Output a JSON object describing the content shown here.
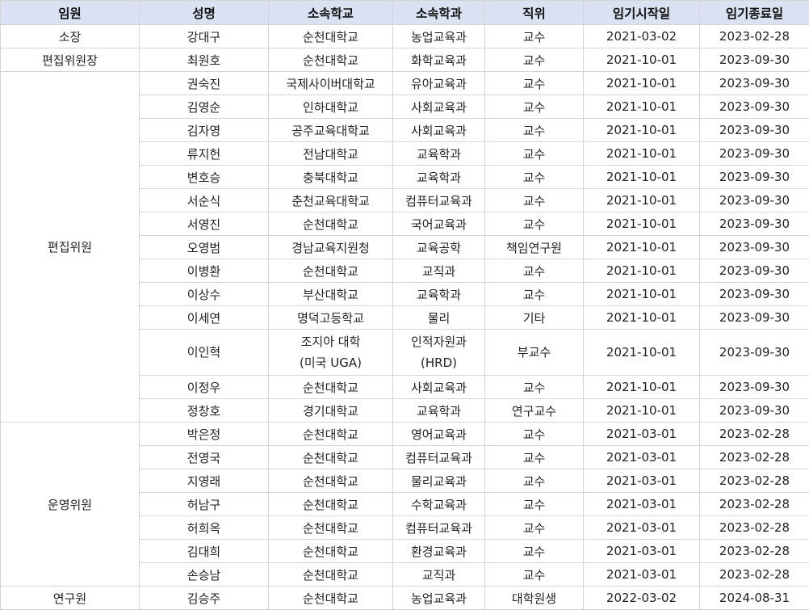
{
  "headers": [
    "임원",
    "성명",
    "소속학교",
    "소속학과",
    "직위",
    "임기시작일",
    "임기종료일"
  ],
  "groups": [
    {
      "role": "소장",
      "members": [
        {
          "name": "강대구",
          "school": "순천대학교",
          "dept": "농업교육과",
          "position": "교수",
          "start": "2021-03-02",
          "end": "2023-02-28"
        }
      ]
    },
    {
      "role": "편집위원장",
      "members": [
        {
          "name": "최원호",
          "school": "순천대학교",
          "dept": "화학교육과",
          "position": "교수",
          "start": "2021-10-01",
          "end": "2023-09-30"
        }
      ]
    },
    {
      "role": "편집위원",
      "members": [
        {
          "name": "권숙진",
          "school": "국제사이버대학교",
          "dept": "유아교육과",
          "position": "교수",
          "start": "2021-10-01",
          "end": "2023-09-30"
        },
        {
          "name": "김영순",
          "school": "인하대학교",
          "dept": "사회교육과",
          "position": "교수",
          "start": "2021-10-01",
          "end": "2023-09-30"
        },
        {
          "name": "김자영",
          "school": "공주교육대학교",
          "dept": "사회교육과",
          "position": "교수",
          "start": "2021-10-01",
          "end": "2023-09-30"
        },
        {
          "name": "류지헌",
          "school": "전남대학교",
          "dept": "교육학과",
          "position": "교수",
          "start": "2021-10-01",
          "end": "2023-09-30"
        },
        {
          "name": "변호승",
          "school": "충북대학교",
          "dept": "교육학과",
          "position": "교수",
          "start": "2021-10-01",
          "end": "2023-09-30"
        },
        {
          "name": "서순식",
          "school": "춘천교육대학교",
          "dept": "컴퓨터교육과",
          "position": "교수",
          "start": "2021-10-01",
          "end": "2023-09-30"
        },
        {
          "name": "서영진",
          "school": "순천대학교",
          "dept": "국어교육과",
          "position": "교수",
          "start": "2021-10-01",
          "end": "2023-09-30"
        },
        {
          "name": "오영범",
          "school": "경남교육지원청",
          "dept": "교육공학",
          "position": "책임연구원",
          "start": "2021-10-01",
          "end": "2023-09-30"
        },
        {
          "name": "이병환",
          "school": "순천대학교",
          "dept": "교직과",
          "position": "교수",
          "start": "2021-10-01",
          "end": "2023-09-30"
        },
        {
          "name": "이상수",
          "school": "부산대학교",
          "dept": "교육학과",
          "position": "교수",
          "start": "2021-10-01",
          "end": "2023-09-30"
        },
        {
          "name": "이세연",
          "school": "명덕고등학교",
          "dept": "물리",
          "position": "기타",
          "start": "2021-10-01",
          "end": "2023-09-30"
        },
        {
          "name": "이인혁",
          "school": [
            "조지아 대학",
            "(미국 UGA)"
          ],
          "dept": [
            "인적자원과",
            "(HRD)"
          ],
          "position": "부교수",
          "start": "2021-10-01",
          "end": "2023-09-30"
        },
        {
          "name": "이정우",
          "school": "순천대학교",
          "dept": "사회교육과",
          "position": "교수",
          "start": "2021-10-01",
          "end": "2023-09-30"
        },
        {
          "name": "정창호",
          "school": "경기대학교",
          "dept": "교육학과",
          "position": "연구교수",
          "start": "2021-10-01",
          "end": "2023-09-30"
        }
      ]
    },
    {
      "role": "운영위원",
      "members": [
        {
          "name": "박은정",
          "school": "순천대학교",
          "dept": "영어교육과",
          "position": "교수",
          "start": "2021-03-01",
          "end": "2023-02-28"
        },
        {
          "name": "전영국",
          "school": "순천대학교",
          "dept": "컴퓨터교육과",
          "position": "교수",
          "start": "2021-03-01",
          "end": "2023-02-28"
        },
        {
          "name": "지영래",
          "school": "순천대학교",
          "dept": "물리교육과",
          "position": "교수",
          "start": "2021-03-01",
          "end": "2023-02-28"
        },
        {
          "name": "허남구",
          "school": "순천대학교",
          "dept": "수학교육과",
          "position": "교수",
          "start": "2021-03-01",
          "end": "2023-02-28"
        },
        {
          "name": "허희옥",
          "school": "순천대학교",
          "dept": "컴퓨터교육과",
          "position": "교수",
          "start": "2021-03-01",
          "end": "2023-02-28"
        },
        {
          "name": "김대희",
          "school": "순천대학교",
          "dept": "환경교육과",
          "position": "교수",
          "start": "2021-03-01",
          "end": "2023-02-28"
        },
        {
          "name": "손승남",
          "school": "순천대학교",
          "dept": "교직과",
          "position": "교수",
          "start": "2021-03-01",
          "end": "2023-02-28"
        }
      ]
    },
    {
      "role": "연구원",
      "members": [
        {
          "name": "김승주",
          "school": "순천대학교",
          "dept": "농업교육과",
          "position": "대학원생",
          "start": "2022-03-02",
          "end": "2024-08-31"
        }
      ]
    }
  ]
}
